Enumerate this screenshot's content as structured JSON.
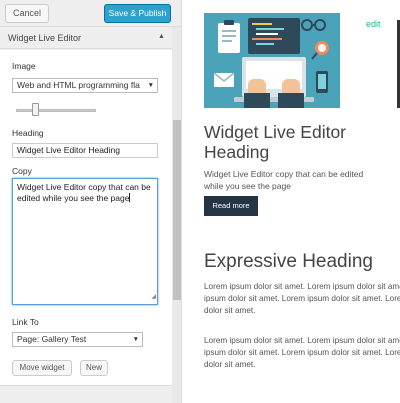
{
  "toolbar": {
    "cancel_label": "Cancel",
    "publish_label": "Save & Publish"
  },
  "widget": {
    "title": "Widget Live Editor",
    "image_label": "Image",
    "image_value": "Web and HTML programming fla",
    "heading_label": "Heading",
    "heading_value": "Widget Live Editor Heading",
    "copy_label": "Copy",
    "copy_value": "Widget Live Editor copy that can be edited while you see the page",
    "link_label": "Link To",
    "link_value": "Page: Gallery Test",
    "move_label": "Move widget",
    "new_label": "New"
  },
  "preview": {
    "edit_label": "edit",
    "heading": "Widget Live Editor Heading",
    "copy": "Widget Live Editor copy that can be edited while you see the page",
    "read_more": "Read more",
    "expressive_heading": "Expressive Heading",
    "lorem_1": "Lorem ipsum dolor sit amet. Lorem ipsum dolor sit amet. Lorem ipsum dolor sit amet. Lorem ipsum dolor sit amet. Lorem ipsum dolor sit amet.",
    "lorem_2": "Lorem ipsum dolor sit amet. Lorem ipsum dolor sit amet. Lorem ipsum dolor sit amet. Lorem ipsum dolor sit amet. Lorem ipsum dolor sit amet."
  },
  "icons": {
    "caret": "caret-up-icon",
    "select_arrow": "triangle-down-icon",
    "hero": "laptop-workspace-illustration"
  },
  "colors": {
    "publish_button": "#2ea2cc",
    "edit_link": "#1fb48f",
    "read_more_bg": "#253544",
    "hero_bg": "#4aa3b8"
  }
}
